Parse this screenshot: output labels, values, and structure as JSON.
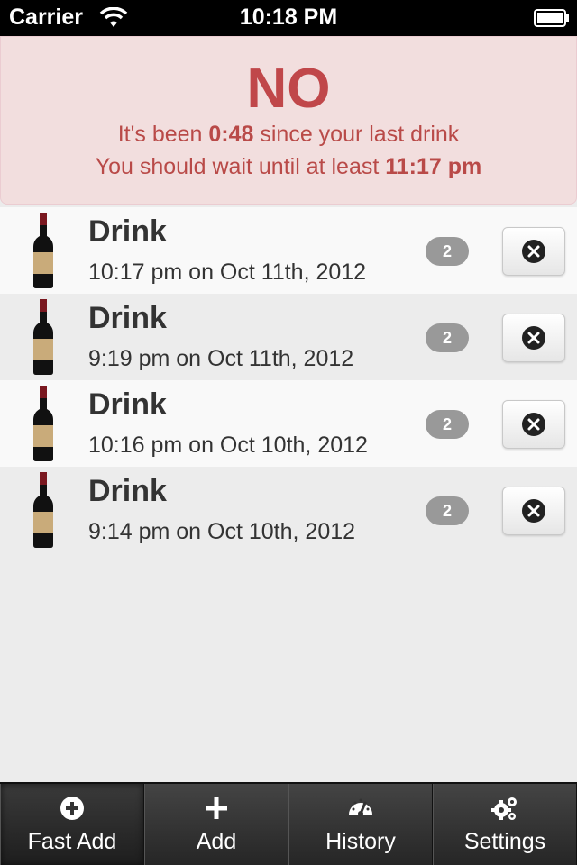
{
  "status_bar": {
    "carrier": "Carrier",
    "time": "10:18 PM"
  },
  "alert": {
    "title": "NO",
    "line1_prefix": "It's been ",
    "line1_value": "0:48",
    "line1_suffix": " since your last drink",
    "line2_prefix": "You should wait until at least ",
    "line2_value": "11:17 pm"
  },
  "drinks": [
    {
      "title": "Drink",
      "timestamp": "10:17 pm on Oct 11th, 2012",
      "count": "2",
      "icon": "wine-bottle-icon"
    },
    {
      "title": "Drink",
      "timestamp": "9:19 pm on Oct 11th, 2012",
      "count": "2",
      "icon": "wine-bottle-icon"
    },
    {
      "title": "Drink",
      "timestamp": "10:16 pm on Oct 10th, 2012",
      "count": "2",
      "icon": "wine-bottle-icon"
    },
    {
      "title": "Drink",
      "timestamp": "9:14 pm on Oct 10th, 2012",
      "count": "2",
      "icon": "wine-bottle-icon"
    }
  ],
  "tabs": [
    {
      "label": "Fast Add",
      "icon": "plus-circle-icon"
    },
    {
      "label": "Add",
      "icon": "plus-icon"
    },
    {
      "label": "History",
      "icon": "gauge-icon"
    },
    {
      "label": "Settings",
      "icon": "gears-icon"
    }
  ],
  "colors": {
    "alert_bg": "#f2dede",
    "alert_text": "#b94a48",
    "badge": "#999999",
    "tabbar": "#2a2a2a"
  }
}
